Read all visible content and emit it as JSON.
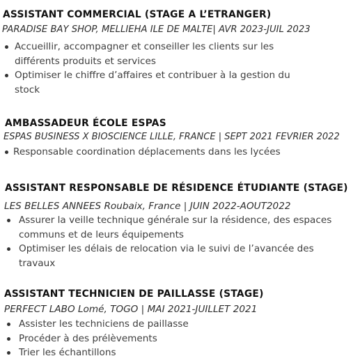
{
  "experiences": [
    {
      "title": "ASSISTANT COMMERCIAL (STAGE A L’ETRANGER)",
      "subtitle": "PARADISE BAY SHOP, MELLIEHA ILE DE MALTE| AVR 2023-JUIL 2023",
      "bullets": [
        "Accueillir, accompagner  et conseiller les clients sur les différents produits et services",
        "Optimiser le chiffre d’affaires et contribuer à la gestion du stock"
      ]
    },
    {
      "title": "AMBASSADEUR ÉCOLE ESPAS",
      "subtitle": "ESPAS BUSINESS X BIOSCIENCE LILLE, FRANCE | SEPT 2021 FEVRIER 2022",
      "bullets": [
        "Responsable coordination déplacements dans les lycées"
      ]
    },
    {
      "title": "ASSISTANT RESPONSABLE DE RÉSIDENCE ÉTUDIANTE (STAGE)",
      "subtitle": "LES BELLES ANNEES  Roubaix, France | JUIN 2022-AOUT2022",
      "bullets": [
        "Assurer la veille technique générale sur la résidence, des espaces communs et de leurs équipements",
        "Optimiser les délais de relocation via le suivi de l’avancée des travaux"
      ]
    },
    {
      "title": "ASSISTANT TECHNICIEN DE PAILLASSE (STAGE)",
      "subtitle": "PERFECT LABO Lomé, TOGO | MAI 2021-JUILLET 2021",
      "bullets": [
        "Assister les techniciens de paillasse",
        "Procéder à des prélèvements",
        "Trier les échantillons"
      ]
    }
  ]
}
